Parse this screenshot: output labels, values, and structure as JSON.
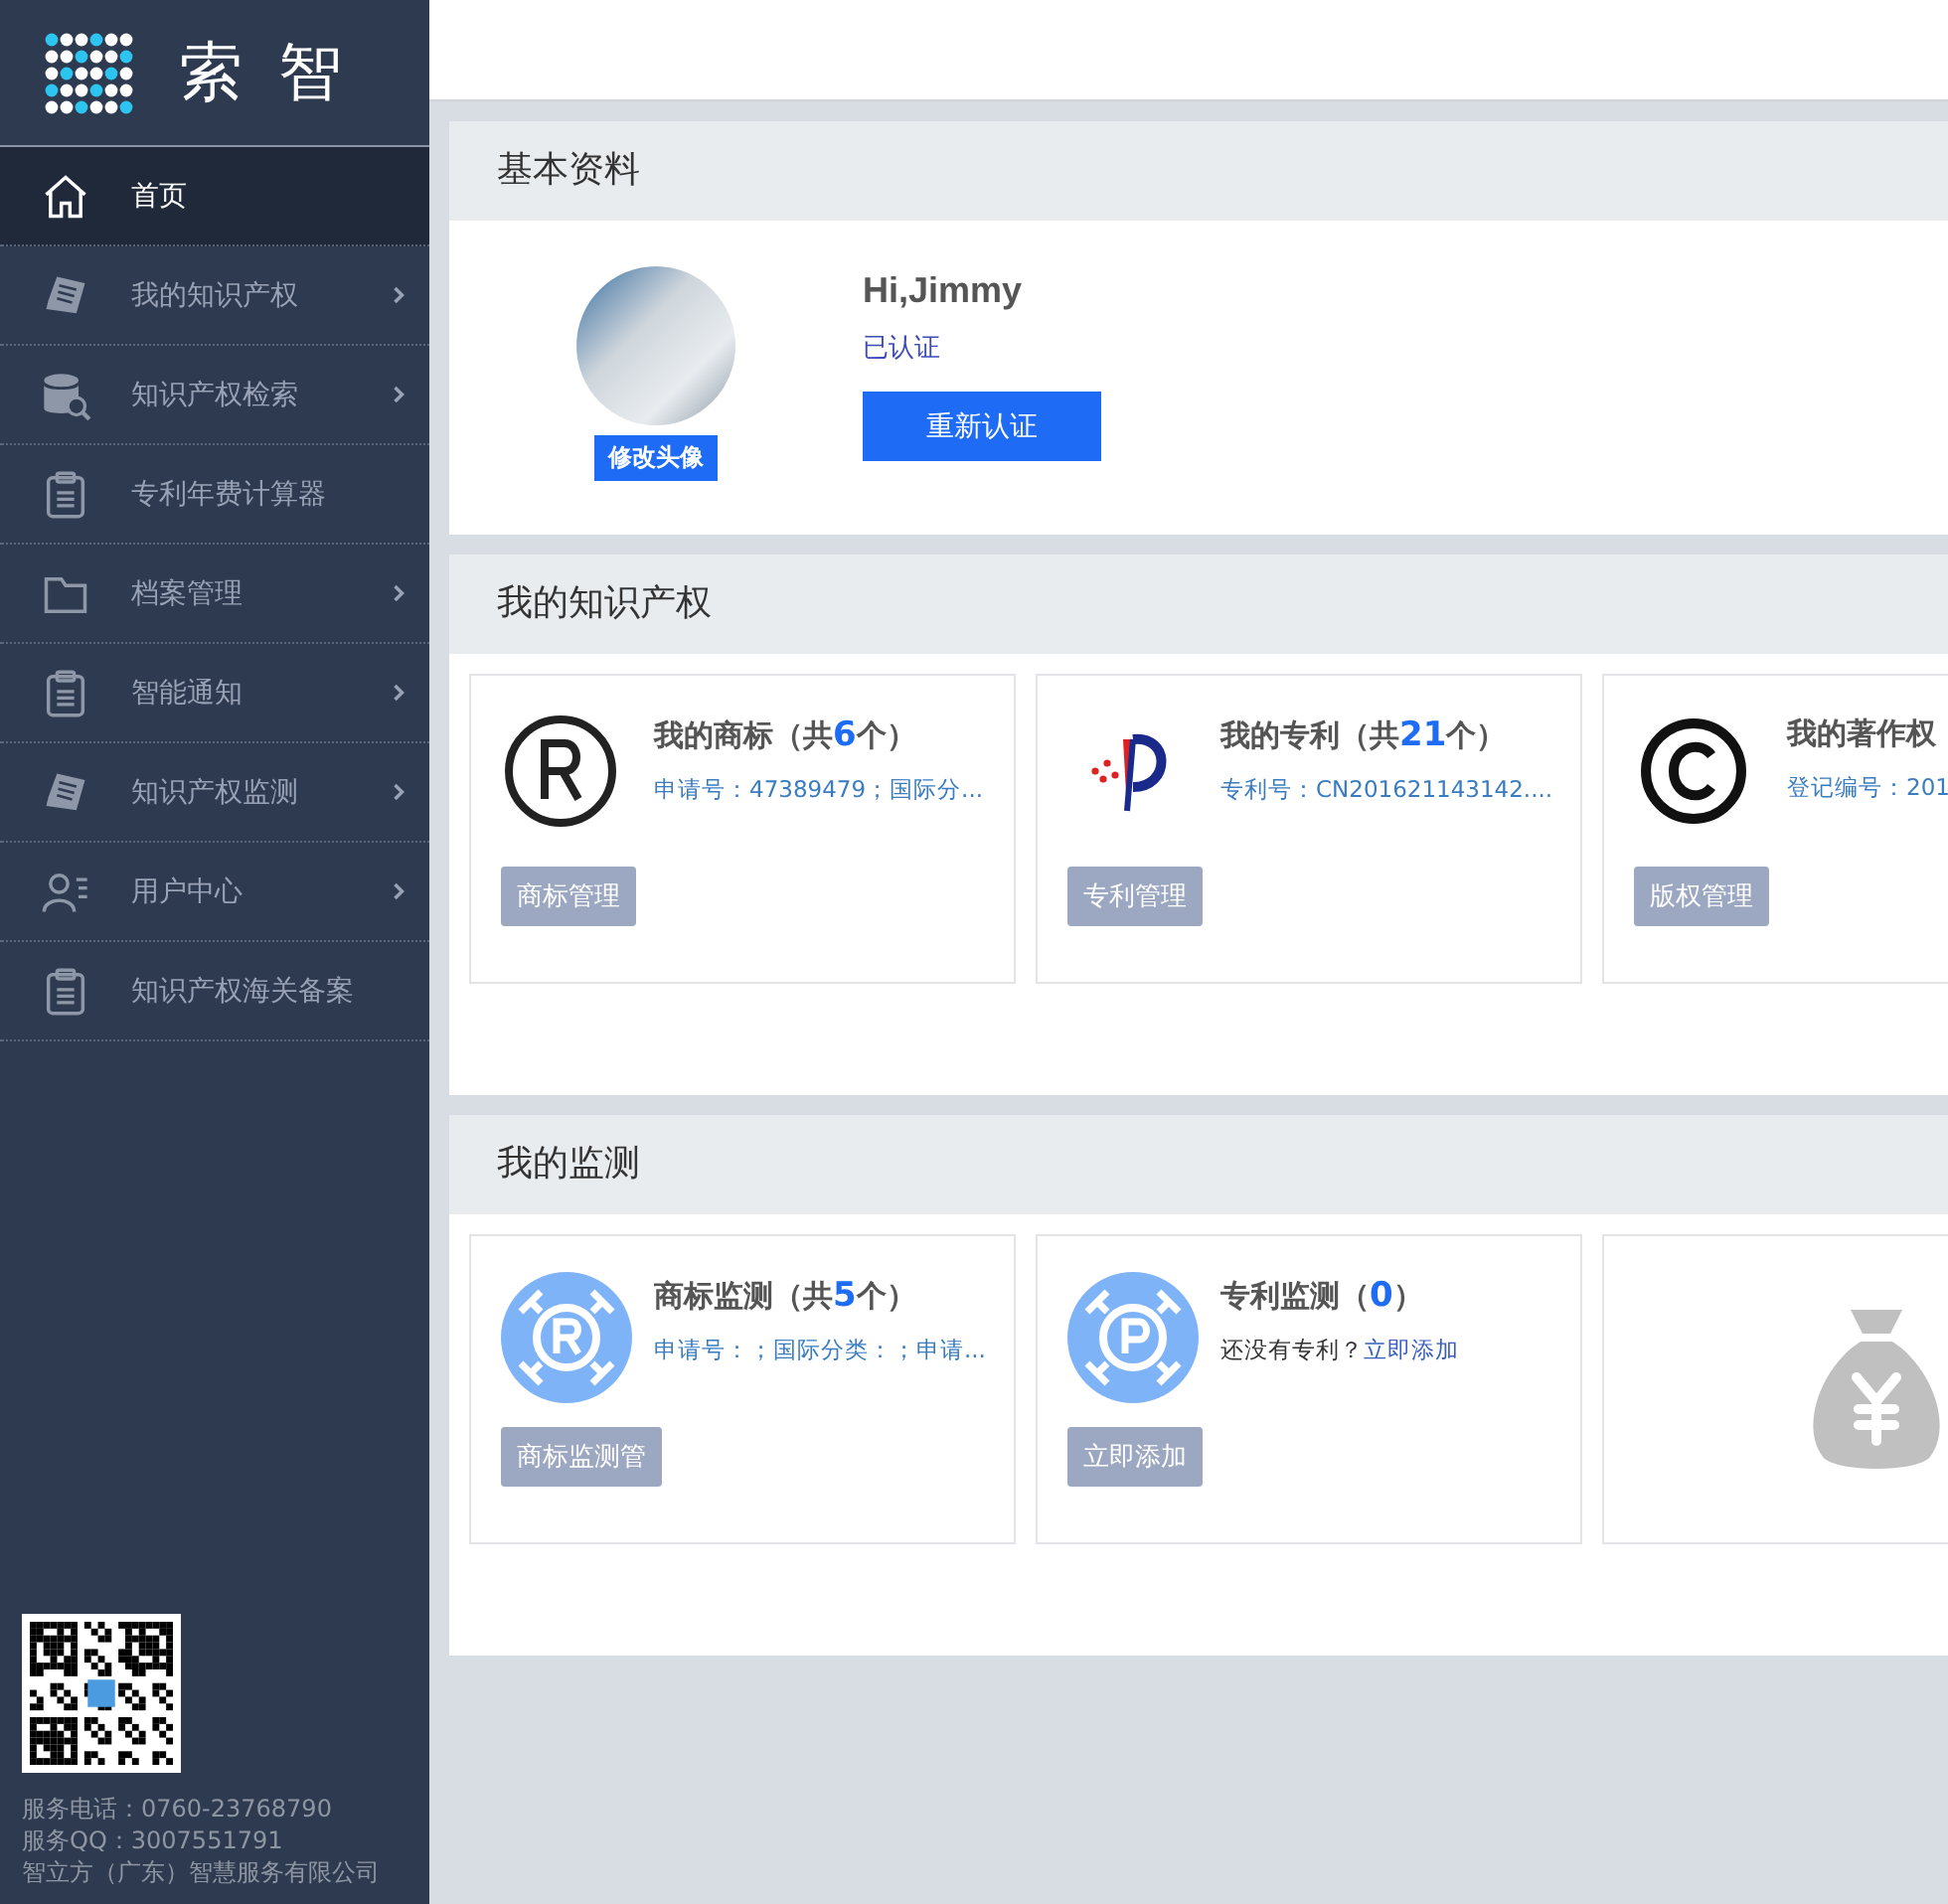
{
  "logo": {
    "text": "索 智"
  },
  "sidebar": {
    "items": [
      {
        "label": "首页",
        "kind": "home",
        "has_arrow": false,
        "selected": true
      },
      {
        "label": "我的知识产权",
        "kind": "document",
        "has_arrow": true,
        "selected": false
      },
      {
        "label": "知识产权检索",
        "kind": "database",
        "has_arrow": true,
        "selected": false
      },
      {
        "label": "专利年费计算器",
        "kind": "clipboard",
        "has_arrow": false,
        "selected": false
      },
      {
        "label": "档案管理",
        "kind": "folder",
        "has_arrow": true,
        "selected": false
      },
      {
        "label": "智能通知",
        "kind": "clipboard",
        "has_arrow": true,
        "selected": false
      },
      {
        "label": "知识产权监测",
        "kind": "document",
        "has_arrow": true,
        "selected": false
      },
      {
        "label": "用户中心",
        "kind": "user",
        "has_arrow": true,
        "selected": false
      },
      {
        "label": "知识产权海关备案",
        "kind": "clipboard",
        "has_arrow": false,
        "selected": false
      }
    ],
    "footer": [
      "服务电话：0760-23768790",
      "服务QQ：3007551791",
      "智立方（广东）智慧服务有限公司"
    ]
  },
  "profile": {
    "title": "基本资料",
    "avatar_button": "修改头像",
    "greeting": "Hi,Jimmy",
    "status": "已认证",
    "reverify_button": "重新认证"
  },
  "ip_section": {
    "title": "我的知识产权",
    "cards": [
      {
        "kind": "registered",
        "title": "我的商标（共**6**个）",
        "detail": "申请号：47389479；国际分...",
        "button": "商标管理"
      },
      {
        "kind": "patent",
        "title": "我的专利（共**21**个）",
        "detail": "专利号：CN201621143142....",
        "button": "专利管理"
      },
      {
        "kind": "copyright",
        "title": "我的著作权",
        "detail": "登记编号：201",
        "button": "版权管理"
      }
    ]
  },
  "monitor_section": {
    "title": "我的监测",
    "cards": [
      {
        "kind": "monitor-r",
        "title": "商标监测（共**5**个）",
        "detail": "申请号：；国际分类：；申请...",
        "button": "商标监测管"
      },
      {
        "kind": "monitor-p",
        "title": "专利监测（**0**）",
        "note": "还没有专利？",
        "link": "立即添加",
        "button": "立即添加"
      },
      {
        "kind": "moneybag"
      }
    ]
  }
}
